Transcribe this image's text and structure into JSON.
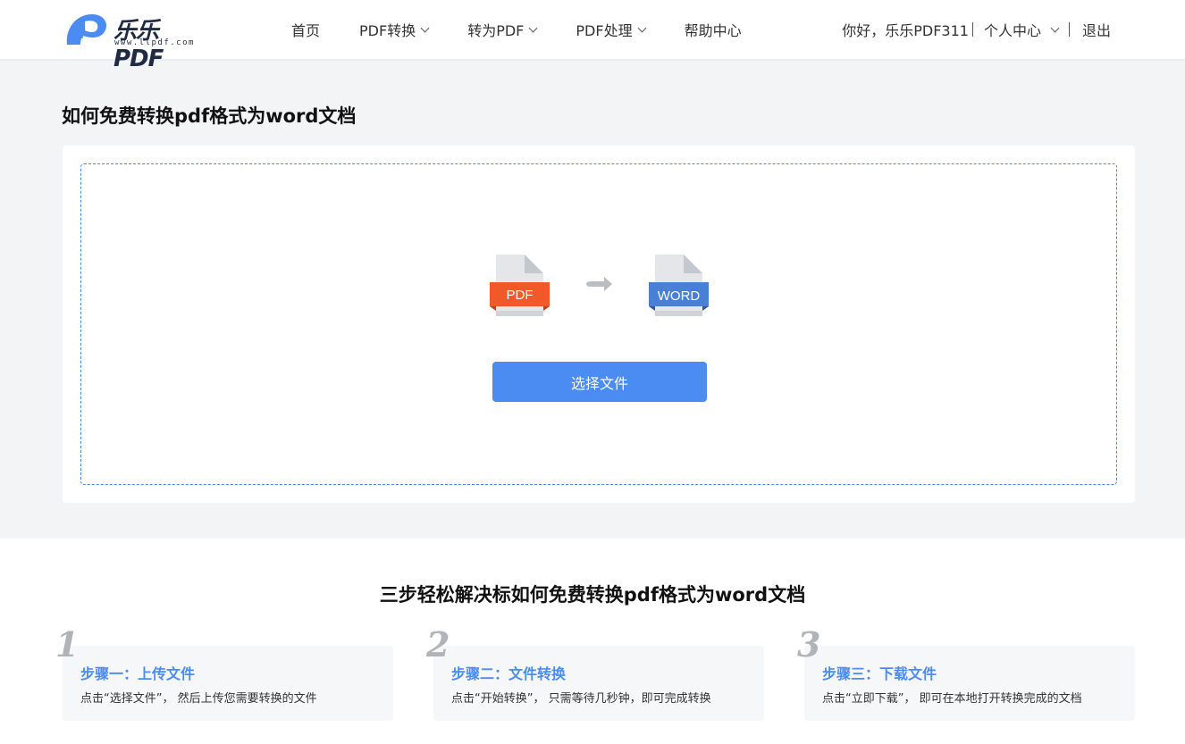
{
  "header": {
    "logo_text": "乐乐PDF",
    "logo_sub": "www.llpdf.com",
    "nav": [
      {
        "label": "首页",
        "has_dropdown": false
      },
      {
        "label": "PDF转换",
        "has_dropdown": true
      },
      {
        "label": "转为PDF",
        "has_dropdown": true
      },
      {
        "label": "PDF处理",
        "has_dropdown": true
      },
      {
        "label": "帮助中心",
        "has_dropdown": false
      }
    ],
    "greeting": "你好，乐乐PDF311",
    "user_center": "个人中心",
    "logout": "退出"
  },
  "main": {
    "title": "如何免费转换pdf格式为word文档",
    "source_label": "PDF",
    "target_label": "WORD",
    "select_button": "选择文件"
  },
  "steps": {
    "title": "三步轻松解决标如何免费转换pdf格式为word文档",
    "items": [
      {
        "num": "1",
        "title": "步骤一：上传文件",
        "desc": "点击“选择文件”， 然后上传您需要转换的文件"
      },
      {
        "num": "2",
        "title": "步骤二：文件转换",
        "desc": "点击“开始转换”， 只需等待几秒钟，即可完成转换"
      },
      {
        "num": "3",
        "title": "步骤三：下载文件",
        "desc": "点击“立即下载”， 即可在本地打开转换完成的文档"
      }
    ]
  },
  "colors": {
    "accent": "#4a8cf1",
    "pdf_badge": "#f05a28",
    "word_badge": "#4a7fd6",
    "background": "#f3f4f6"
  },
  "icons": {
    "logo": "llpdf-logo-icon",
    "source": "pdf-file-icon",
    "target": "word-file-icon",
    "arrow": "arrow-right-icon",
    "dropdown": "chevron-down-icon"
  }
}
